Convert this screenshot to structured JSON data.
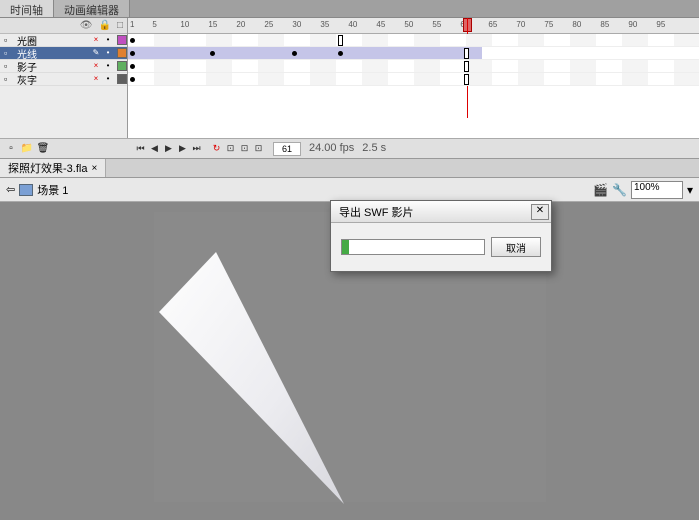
{
  "panels": {
    "tab1": "时间轴",
    "tab2": "动画编辑器"
  },
  "layer_header": {
    "eye": "●",
    "lock": "🔒",
    "outline": "□"
  },
  "layers": [
    {
      "name": "光圈",
      "color": "#c050c0"
    },
    {
      "name": "光线",
      "color": "#e08030"
    },
    {
      "name": "影子",
      "color": "#60b060"
    },
    {
      "name": "灰字",
      "color": "#606060"
    }
  ],
  "ruler_ticks": [
    1,
    5,
    10,
    15,
    20,
    25,
    30,
    35,
    40,
    45,
    50,
    55,
    60,
    65,
    70,
    75,
    80,
    85,
    90,
    95
  ],
  "playback": {
    "current_frame": "61",
    "fps": "24.00",
    "fps_label": "fps",
    "time": "2.5",
    "time_label": "s"
  },
  "doc_tab": "探照灯效果-3.fla",
  "breadcrumb": {
    "scene": "场景 1"
  },
  "zoom": "100%",
  "dialog": {
    "title": "导出 SWF 影片",
    "cancel": "取消"
  }
}
